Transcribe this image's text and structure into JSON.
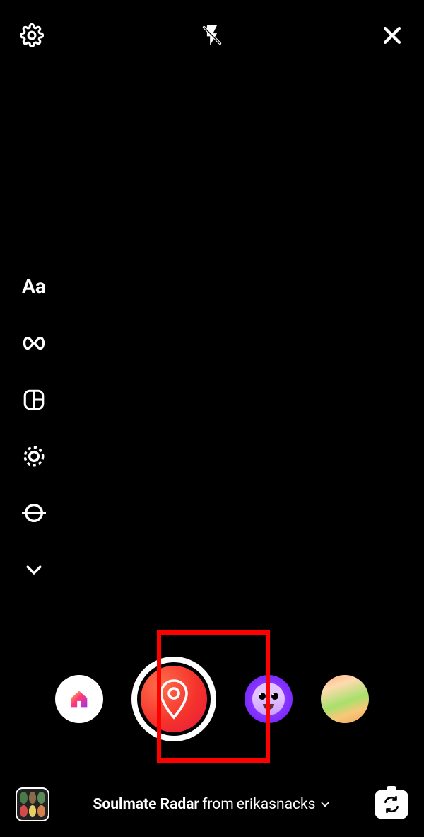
{
  "top_bar": {
    "settings": "settings",
    "flash": "flash-off",
    "close": "close"
  },
  "side_tools": {
    "text": "Aa",
    "boomerang": "infinity",
    "layout": "layout",
    "multicapture": "dashed-circle",
    "level": "level",
    "more": "chevron-down"
  },
  "filters": {
    "home_icon": "home",
    "capture_icon": "location-pin",
    "face_filter": "face",
    "gradient_filter": "gradient"
  },
  "effect": {
    "name": "Soulmate Radar",
    "separator": " from ",
    "creator": "erikasnacks"
  },
  "bottom": {
    "gallery": "gallery",
    "switch_camera": "switch"
  },
  "gallery_colors": [
    "#4a7a4a",
    "#8a6a4a",
    "#5a8a5a",
    "#d44a4a",
    "#e8d060",
    "#d4804a"
  ]
}
